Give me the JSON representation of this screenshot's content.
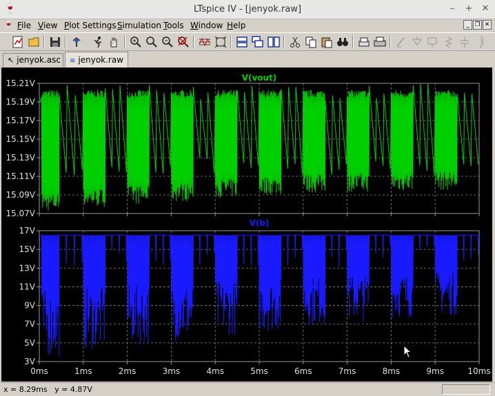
{
  "window": {
    "title": "LTspice IV - [jenyok.raw]"
  },
  "menu": [
    {
      "label": "File",
      "u": "F",
      "rest": "ile"
    },
    {
      "label": "View",
      "u": "V",
      "rest": "iew"
    },
    {
      "label": "Plot Settings",
      "u": "P",
      "rest": "lot Settings"
    },
    {
      "label": "Simulation",
      "u": "S",
      "rest": "imulation"
    },
    {
      "label": "Tools",
      "u": "T",
      "rest": "ools"
    },
    {
      "label": "Window",
      "u": "W",
      "rest": "indow"
    },
    {
      "label": "Help",
      "u": "H",
      "rest": "elp"
    }
  ],
  "tabs": [
    {
      "label": "jenyok.asc",
      "active": false
    },
    {
      "label": "jenyok.raw",
      "active": true
    }
  ],
  "status": {
    "x_readout": "x = 8.29ms",
    "y_readout": "y = 4.87V"
  },
  "chart_data": [
    {
      "type": "line",
      "title": "V(vout)",
      "color": "#00d000",
      "ylim": [
        15.07,
        15.21
      ],
      "yticks": [
        "15.21V",
        "15.19V",
        "15.17V",
        "15.15V",
        "15.13V",
        "15.11V",
        "15.09V",
        "15.07V"
      ],
      "xlim": [
        0,
        10
      ],
      "xunit": "ms",
      "bursts": [
        {
          "start": 0.05,
          "end": 0.45,
          "min": 15.072
        },
        {
          "start": 1.0,
          "end": 1.5,
          "min": 15.077
        },
        {
          "start": 2.0,
          "end": 2.5,
          "min": 15.08
        },
        {
          "start": 3.0,
          "end": 3.5,
          "min": 15.083
        },
        {
          "start": 4.0,
          "end": 4.5,
          "min": 15.087
        },
        {
          "start": 5.0,
          "end": 5.5,
          "min": 15.09
        },
        {
          "start": 6.0,
          "end": 6.5,
          "min": 15.092
        },
        {
          "start": 7.0,
          "end": 7.5,
          "min": 15.093
        },
        {
          "start": 8.0,
          "end": 8.5,
          "min": 15.094
        },
        {
          "start": 9.0,
          "end": 9.5,
          "min": 15.095
        }
      ]
    },
    {
      "type": "line",
      "title": "V(b)",
      "color": "#1a1aff",
      "ylim": [
        3,
        17.8
      ],
      "yticks": [
        "17V",
        "15V",
        "13V",
        "11V",
        "9V",
        "7V",
        "5V",
        "3V"
      ],
      "xlim": [
        0,
        10
      ],
      "xunit": "ms",
      "xticks": [
        "0ms",
        "1ms",
        "2ms",
        "3ms",
        "4ms",
        "5ms",
        "6ms",
        "7ms",
        "8ms",
        "9ms",
        "10ms"
      ],
      "bursts": [
        {
          "start": 0.05,
          "end": 0.45,
          "min": 3.5
        },
        {
          "start": 1.0,
          "end": 1.5,
          "min": 4.3
        },
        {
          "start": 2.0,
          "end": 2.5,
          "min": 4.9
        },
        {
          "start": 3.0,
          "end": 3.5,
          "min": 5.3
        },
        {
          "start": 4.0,
          "end": 4.5,
          "min": 6.0
        },
        {
          "start": 5.0,
          "end": 5.5,
          "min": 6.4
        },
        {
          "start": 6.0,
          "end": 6.5,
          "min": 7.1
        },
        {
          "start": 7.0,
          "end": 7.5,
          "min": 7.5
        },
        {
          "start": 8.0,
          "end": 8.5,
          "min": 7.9
        },
        {
          "start": 9.0,
          "end": 9.5,
          "min": 8.2
        }
      ]
    }
  ]
}
